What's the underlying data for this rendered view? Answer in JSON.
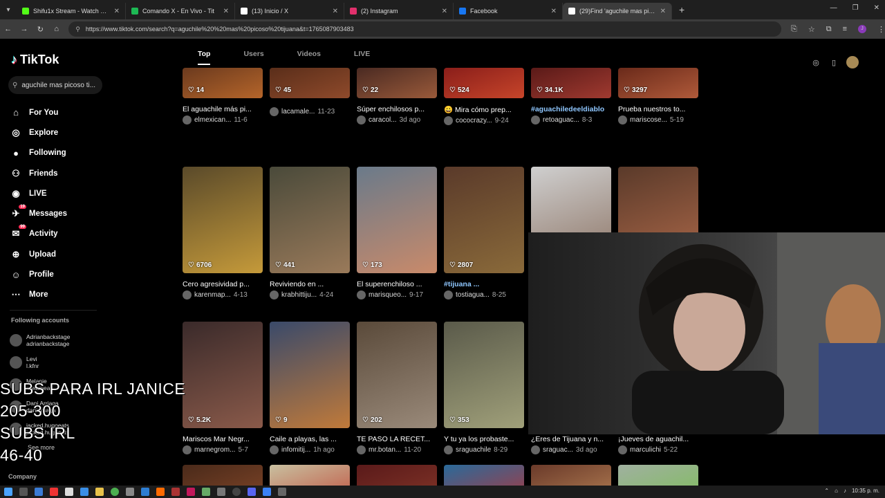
{
  "browser": {
    "tabs": [
      {
        "label": "Shifu1x Stream - Watch Live on",
        "color": "#53fc18"
      },
      {
        "label": "Comando X - En Vivo - Tit",
        "color": "#1db954"
      },
      {
        "label": "(13) Inicio / X",
        "color": "#ffffff"
      },
      {
        "label": "(2) Instagram",
        "color": "#e1306c"
      },
      {
        "label": "Facebook",
        "color": "#1877f2"
      },
      {
        "label": "(29)Find 'aguchile mas picoso ti",
        "color": "#ffffff"
      }
    ],
    "url": "https://www.tiktok.com/search?q=aguchile%20%20mas%20picoso%20tijuana&t=1765087903483",
    "profile_initial": "J"
  },
  "tiktok": {
    "brand": "TikTok",
    "search_value": "aguchile mas picoso ti...",
    "nav": [
      {
        "label": "For You",
        "icon": "⌂"
      },
      {
        "label": "Explore",
        "icon": "◎"
      },
      {
        "label": "Following",
        "icon": "●"
      },
      {
        "label": "Friends",
        "icon": "⚇"
      },
      {
        "label": "LIVE",
        "icon": "◉"
      },
      {
        "label": "Messages",
        "icon": "✈",
        "badge": "19"
      },
      {
        "label": "Activity",
        "icon": "✉",
        "badge": "99"
      },
      {
        "label": "Upload",
        "icon": "⊕"
      },
      {
        "label": "Profile",
        "icon": "☺"
      },
      {
        "label": "More",
        "icon": "⋯"
      }
    ],
    "following_title": "Following accounts",
    "following": [
      {
        "name": "Adrianbackstage",
        "handle": "adrianbackstage"
      },
      {
        "name": "Levi",
        "handle": "l.kfnr"
      },
      {
        "name": "Melanie",
        "handle": "melanieas"
      },
      {
        "name": "Dani Arriaga",
        "handle": "daniarriaga"
      },
      {
        "name": "jacked.hugoeats",
        "handle": "jacked.hugoeats"
      }
    ],
    "see_more": "See more",
    "company": "Company",
    "tabs": [
      "Top",
      "Users",
      "Videos",
      "LIVE"
    ],
    "videos": [
      {
        "likes": "14",
        "caption": "El aguachile más pi...",
        "user": "elmexican...",
        "date": "11-6",
        "colors": [
          "#6b3a1e",
          "#b5652a"
        ]
      },
      {
        "likes": "45",
        "caption": "",
        "user": "lacamale...",
        "date": "11-23",
        "colors": [
          "#5a2e1a",
          "#8f4a2b"
        ]
      },
      {
        "likes": "22",
        "caption": "Súper enchilosos p...",
        "user": "caracol...",
        "date": "3d ago",
        "colors": [
          "#4a2a22",
          "#9a5a3a"
        ]
      },
      {
        "likes": "524",
        "caption": "😀 Mira cómo prep...",
        "user": "cococrazy...",
        "date": "9-24",
        "colors": [
          "#8a1e1a",
          "#c7452a"
        ]
      },
      {
        "likes": "34.1K",
        "caption": "#aguachiledeeldiablo",
        "user": "retoaguac...",
        "date": "8-3",
        "colors": [
          "#5a1a18",
          "#a03a30"
        ],
        "tag": true
      },
      {
        "likes": "3297",
        "caption": "Prueba nuestros to...",
        "user": "mariscose...",
        "date": "5-19",
        "colors": [
          "#6a2a1a",
          "#b05a3a"
        ]
      },
      {
        "likes": "6706",
        "caption": "Cero agresividad p...",
        "user": "karenmap...",
        "date": "4-13",
        "colors": [
          "#5a4a2a",
          "#c59a3a"
        ]
      },
      {
        "likes": "441",
        "caption": "Reviviendo en ...",
        "user": "krabhittiju...",
        "date": "4-24",
        "colors": [
          "#4a4a3a",
          "#9a7a5a"
        ]
      },
      {
        "likes": "173",
        "caption": "El superenchiloso ...",
        "user": "marisqueo...",
        "date": "9-17",
        "colors": [
          "#6a7a8a",
          "#c98a6a"
        ]
      },
      {
        "likes": "2807",
        "caption": "#tijuana ...",
        "user": "tostiagua...",
        "date": "8-25",
        "colors": [
          "#5a3a2a",
          "#8a6a3a"
        ],
        "tag": true
      },
      {
        "likes": "",
        "caption": "",
        "user": "",
        "date": "",
        "colors": [
          "#cfcfcf",
          "#8a7060"
        ]
      },
      {
        "likes": "",
        "caption": "",
        "user": "",
        "date": "",
        "colors": [
          "#5a3a2a",
          "#b06a4a"
        ]
      },
      {
        "likes": "5.2K",
        "caption": "Mariscos Mar Negr...",
        "user": "marnegrom...",
        "date": "5-7",
        "colors": [
          "#3a2a2a",
          "#8a5a4a"
        ]
      },
      {
        "likes": "9",
        "caption": "Caile a playas, las ...",
        "user": "infomitij...",
        "date": "1h ago",
        "colors": [
          "#3a4a6a",
          "#c07a3a"
        ]
      },
      {
        "likes": "202",
        "caption": "TE PASO LA RECET...",
        "user": "mr.botan...",
        "date": "11-20",
        "colors": [
          "#5a4a3a",
          "#9a8a7a"
        ]
      },
      {
        "likes": "353",
        "caption": "Y tu ya los probaste...",
        "user": "sraguachile",
        "date": "8-29",
        "colors": [
          "#5a5a4a",
          "#a0a07a"
        ]
      },
      {
        "likes": "",
        "caption": "¿Eres de Tijuana y n...",
        "user": "sraguac...",
        "date": "3d ago",
        "colors": [
          "#2a2a2a",
          "#3a3a3a"
        ]
      },
      {
        "likes": "",
        "caption": "¡Jueves de aguachil...",
        "user": "marculichi",
        "date": "5-22",
        "colors": [
          "#2a2a2a",
          "#3a3a3a"
        ]
      },
      {
        "likes": "",
        "caption": "",
        "user": "",
        "date": "",
        "colors": [
          "#4a2a1a",
          "#8a4a2a"
        ]
      },
      {
        "likes": "",
        "caption": "",
        "user": "",
        "date": "",
        "colors": [
          "#c8c0a0",
          "#c04030"
        ]
      },
      {
        "likes": "",
        "caption": "",
        "user": "",
        "date": "",
        "colors": [
          "#5a1a1a",
          "#8a3a2a"
        ]
      },
      {
        "likes": "",
        "caption": "",
        "user": "",
        "date": "",
        "colors": [
          "#2a6a9a",
          "#c03030"
        ]
      },
      {
        "likes": "",
        "caption": "",
        "user": "",
        "date": "",
        "colors": [
          "#6a3a2a",
          "#c08a5a"
        ]
      },
      {
        "likes": "",
        "caption": "",
        "user": "",
        "date": "",
        "colors": [
          "#a0b0a0",
          "#7ac050"
        ]
      }
    ]
  },
  "overlay": {
    "line1": "SUBS PARA IRL JANICE",
    "line2": "205-300",
    "line3": "SUBS IRL",
    "line4": "46-40"
  },
  "taskbar": {
    "time": "10:35 p. m."
  }
}
